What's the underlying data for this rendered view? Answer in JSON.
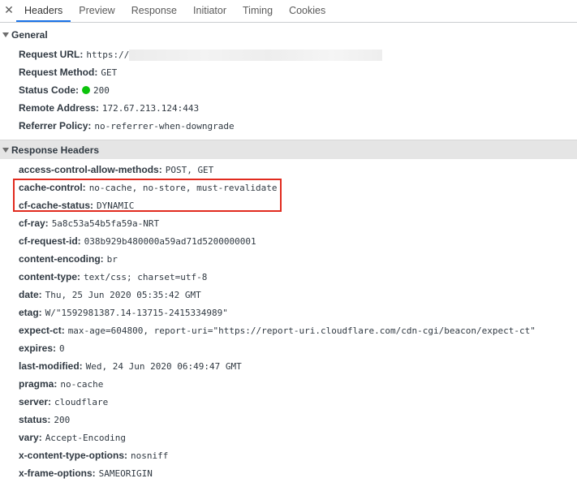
{
  "tabs": {
    "close_icon": "✕",
    "items": [
      "Headers",
      "Preview",
      "Response",
      "Initiator",
      "Timing",
      "Cookies"
    ],
    "active": "Headers"
  },
  "general": {
    "title": "General",
    "request_url": {
      "key": "Request URL:",
      "value": "https://"
    },
    "request_method": {
      "key": "Request Method:",
      "value": "GET"
    },
    "status_code": {
      "key": "Status Code:",
      "value": "200",
      "dot_color": "#0bc30b"
    },
    "remote_address": {
      "key": "Remote Address:",
      "value": "172.67.213.124:443"
    },
    "referrer_policy": {
      "key": "Referrer Policy:",
      "value": "no-referrer-when-downgrade"
    }
  },
  "response_headers": {
    "title": "Response Headers",
    "items": [
      {
        "key": "access-control-allow-methods:",
        "value": "POST, GET"
      },
      {
        "key": "cache-control:",
        "value": "no-cache, no-store, must-revalidate"
      },
      {
        "key": "cf-cache-status:",
        "value": "DYNAMIC"
      },
      {
        "key": "cf-ray:",
        "value": "5a8c53a54b5fa59a-NRT"
      },
      {
        "key": "cf-request-id:",
        "value": "038b929b480000a59ad71d5200000001"
      },
      {
        "key": "content-encoding:",
        "value": "br"
      },
      {
        "key": "content-type:",
        "value": "text/css; charset=utf-8"
      },
      {
        "key": "date:",
        "value": "Thu, 25 Jun 2020 05:35:42 GMT"
      },
      {
        "key": "etag:",
        "value": "W/\"1592981387.14-13715-2415334989\""
      },
      {
        "key": "expect-ct:",
        "value": "max-age=604800, report-uri=\"https://report-uri.cloudflare.com/cdn-cgi/beacon/expect-ct\""
      },
      {
        "key": "expires:",
        "value": "0"
      },
      {
        "key": "last-modified:",
        "value": "Wed, 24 Jun 2020 06:49:47 GMT"
      },
      {
        "key": "pragma:",
        "value": "no-cache"
      },
      {
        "key": "server:",
        "value": "cloudflare"
      },
      {
        "key": "status:",
        "value": "200"
      },
      {
        "key": "vary:",
        "value": "Accept-Encoding"
      },
      {
        "key": "x-content-type-options:",
        "value": "nosniff"
      },
      {
        "key": "x-frame-options:",
        "value": "SAMEORIGIN"
      }
    ]
  },
  "annotation": {
    "highlight_color": "#e12b1f"
  }
}
